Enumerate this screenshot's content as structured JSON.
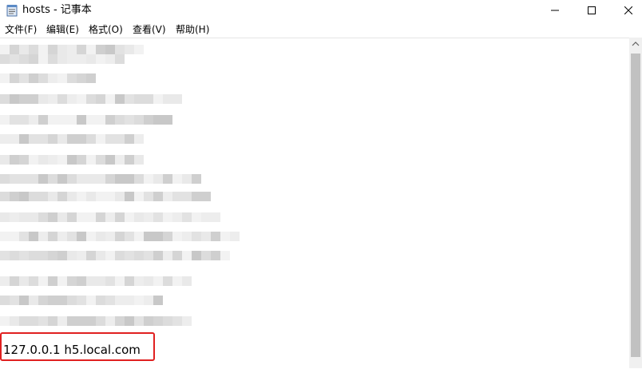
{
  "window": {
    "title": "hosts - 记事本",
    "icon": "notepad-icon",
    "controls": [
      "minimize-icon",
      "maximize-icon",
      "close-icon"
    ]
  },
  "menu": {
    "items": [
      {
        "label": "文件(F)"
      },
      {
        "label": "编辑(E)"
      },
      {
        "label": "格式(O)"
      },
      {
        "label": "查看(V)"
      },
      {
        "label": "帮助(H)"
      }
    ]
  },
  "editor": {
    "visible_line": "127.0.0.1 h5.local.com",
    "highlight_color": "#e02020"
  }
}
